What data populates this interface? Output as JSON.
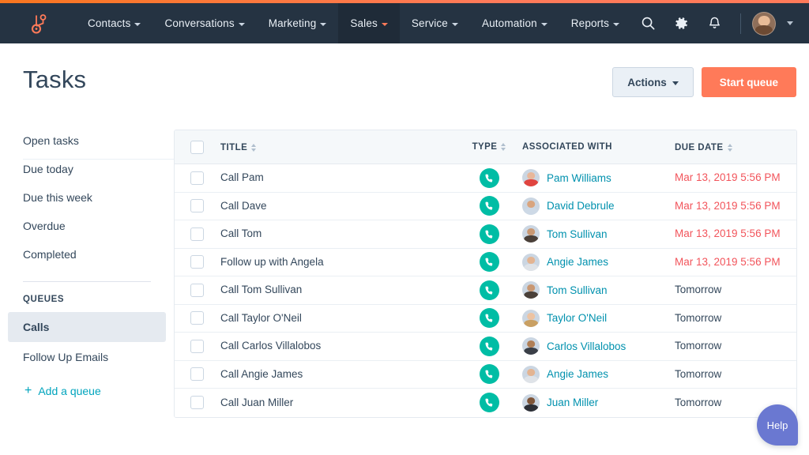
{
  "nav": {
    "logo_icon": "hubspot-sprocket-icon",
    "items": [
      {
        "label": "Contacts",
        "active": false
      },
      {
        "label": "Conversations",
        "active": false
      },
      {
        "label": "Marketing",
        "active": false
      },
      {
        "label": "Sales",
        "active": true
      },
      {
        "label": "Service",
        "active": false
      },
      {
        "label": "Automation",
        "active": false
      },
      {
        "label": "Reports",
        "active": false
      }
    ],
    "right_icons": [
      "search-icon",
      "gear-icon",
      "bell-icon"
    ],
    "avatar": "user-avatar"
  },
  "header": {
    "title": "Tasks",
    "actions_label": "Actions",
    "start_queue_label": "Start queue"
  },
  "sidebar": {
    "views": [
      {
        "label": "Open tasks"
      },
      {
        "label": "Due today"
      },
      {
        "label": "Due this week"
      },
      {
        "label": "Overdue"
      },
      {
        "label": "Completed"
      }
    ],
    "queues_title": "QUEUES",
    "queues": [
      {
        "label": "Calls",
        "selected": true
      },
      {
        "label": "Follow Up Emails",
        "selected": false
      }
    ],
    "add_queue_label": "Add a queue",
    "add_queue_icon": "plus-icon"
  },
  "table": {
    "columns": [
      {
        "label": "TITLE",
        "sortable": true
      },
      {
        "label": "TYPE",
        "sortable": true
      },
      {
        "label": "ASSOCIATED WITH",
        "sortable": false
      },
      {
        "label": "DUE DATE",
        "sortable": true
      }
    ],
    "rows": [
      {
        "title": "Call Pam",
        "type_icon": "phone-icon",
        "contact": "Pam Williams",
        "due": "Mar 13, 2019 5:56 PM",
        "overdue": true,
        "skin": "#e8b79a",
        "hair": "#5b3a29",
        "shirt": "#e0443f"
      },
      {
        "title": "Call Dave",
        "type_icon": "phone-icon",
        "contact": "David Debrule",
        "due": "Mar 13, 2019 5:56 PM",
        "overdue": true,
        "skin": "#d9a57f",
        "hair": "#2e2723",
        "shirt": "#cdd9e6"
      },
      {
        "title": "Call Tom",
        "type_icon": "phone-icon",
        "contact": "Tom Sullivan",
        "due": "Mar 13, 2019 5:56 PM",
        "overdue": true,
        "skin": "#c99873",
        "hair": "#3b2f26",
        "shirt": "#4a4039"
      },
      {
        "title": "Follow up with Angela",
        "type_icon": "phone-icon",
        "contact": "Angie James",
        "due": "Mar 13, 2019 5:56 PM",
        "overdue": true,
        "skin": "#e3b492",
        "hair": "#6b4a32",
        "shirt": "#dfe3e8"
      },
      {
        "title": "Call Tom Sullivan",
        "type_icon": "phone-icon",
        "contact": "Tom Sullivan",
        "due": "Tomorrow",
        "overdue": false,
        "skin": "#c99873",
        "hair": "#3b2f26",
        "shirt": "#4a4039"
      },
      {
        "title": "Call Taylor O'Neil",
        "type_icon": "phone-icon",
        "contact": "Taylor O'Neil",
        "due": "Tomorrow",
        "overdue": false,
        "skin": "#edc3a2",
        "hair": "#c9a063",
        "shirt": "#4c5a68"
      },
      {
        "title": "Call Carlos Villalobos",
        "type_icon": "phone-icon",
        "contact": "Carlos Villalobos",
        "due": "Tomorrow",
        "overdue": false,
        "skin": "#b07f56",
        "hair": "#241d18",
        "shirt": "#3a3f47"
      },
      {
        "title": "Call Angie James",
        "type_icon": "phone-icon",
        "contact": "Angie James",
        "due": "Tomorrow",
        "overdue": false,
        "skin": "#e3b492",
        "hair": "#6b4a32",
        "shirt": "#dfe3e8"
      },
      {
        "title": "Call Juan Miller",
        "type_icon": "phone-icon",
        "contact": "Juan Miller",
        "due": "Tomorrow",
        "overdue": false,
        "skin": "#7e5538",
        "hair": "#1a1512",
        "shirt": "#2c2f36"
      }
    ]
  },
  "help": {
    "label": "Help"
  },
  "colors": {
    "accent_orange": "#ff7a59",
    "nav_navy": "#253342",
    "link_teal": "#0091ae",
    "type_teal": "#00bda5",
    "overdue_red": "#f2545b",
    "text_slate": "#33475b",
    "help_purple": "#6a78d1"
  }
}
